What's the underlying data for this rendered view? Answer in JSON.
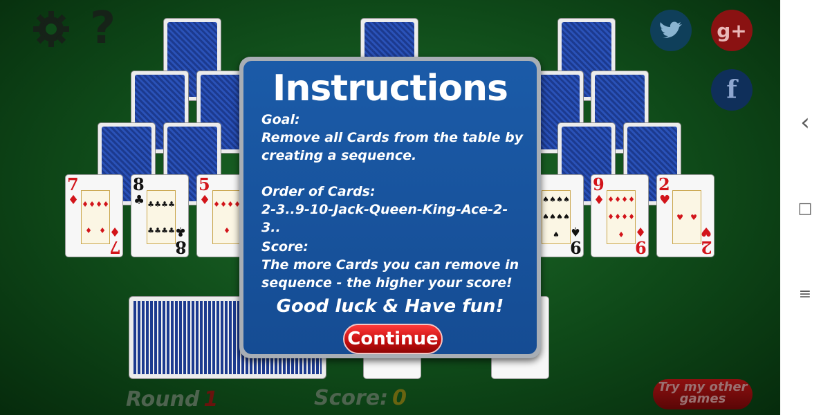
{
  "hud": {
    "round_label": "Round",
    "round_value": "1",
    "score_label": "Score:",
    "score_value": "0"
  },
  "top_icons": {
    "settings": "gear-icon",
    "help": "help-icon",
    "twitter": "twitter-icon",
    "google_plus": "google-plus-icon",
    "google_plus_text": "g+",
    "facebook": "facebook-icon",
    "facebook_text": "f"
  },
  "bottom_row_cards": [
    {
      "rank": "7",
      "suit": "♦",
      "color": "red"
    },
    {
      "rank": "8",
      "suit": "♣",
      "color": "black"
    },
    {
      "rank": "5",
      "suit": "♦",
      "color": "red"
    },
    {
      "rank": "9",
      "suit": "♠",
      "color": "black"
    },
    {
      "rank": "9",
      "suit": "♦",
      "color": "red"
    },
    {
      "rank": "2",
      "suit": "♥",
      "color": "red"
    }
  ],
  "modal": {
    "title": "Instructions",
    "goal_heading": "Goal:",
    "goal_text": "Remove all Cards from the table by creating a sequence.",
    "order_heading": "Order of Cards:",
    "order_text": "2-3..9-10-Jack-Queen-King-Ace-2-3..",
    "score_heading": "Score:",
    "score_text": "The more Cards you can remove in sequence - the higher your score!",
    "good_luck": "Good luck & Have fun!",
    "continue_label": "Continue"
  },
  "try_other_games": "Try my other games",
  "navbar": {
    "back_icon": "‹",
    "home_icon": "□",
    "menu_icon": "≡"
  },
  "colors": {
    "table_green": "#1f6e2a",
    "modal_blue": "#1b5ba8",
    "button_red": "#c30d0d",
    "round_value_color": "#7a0c0c"
  }
}
